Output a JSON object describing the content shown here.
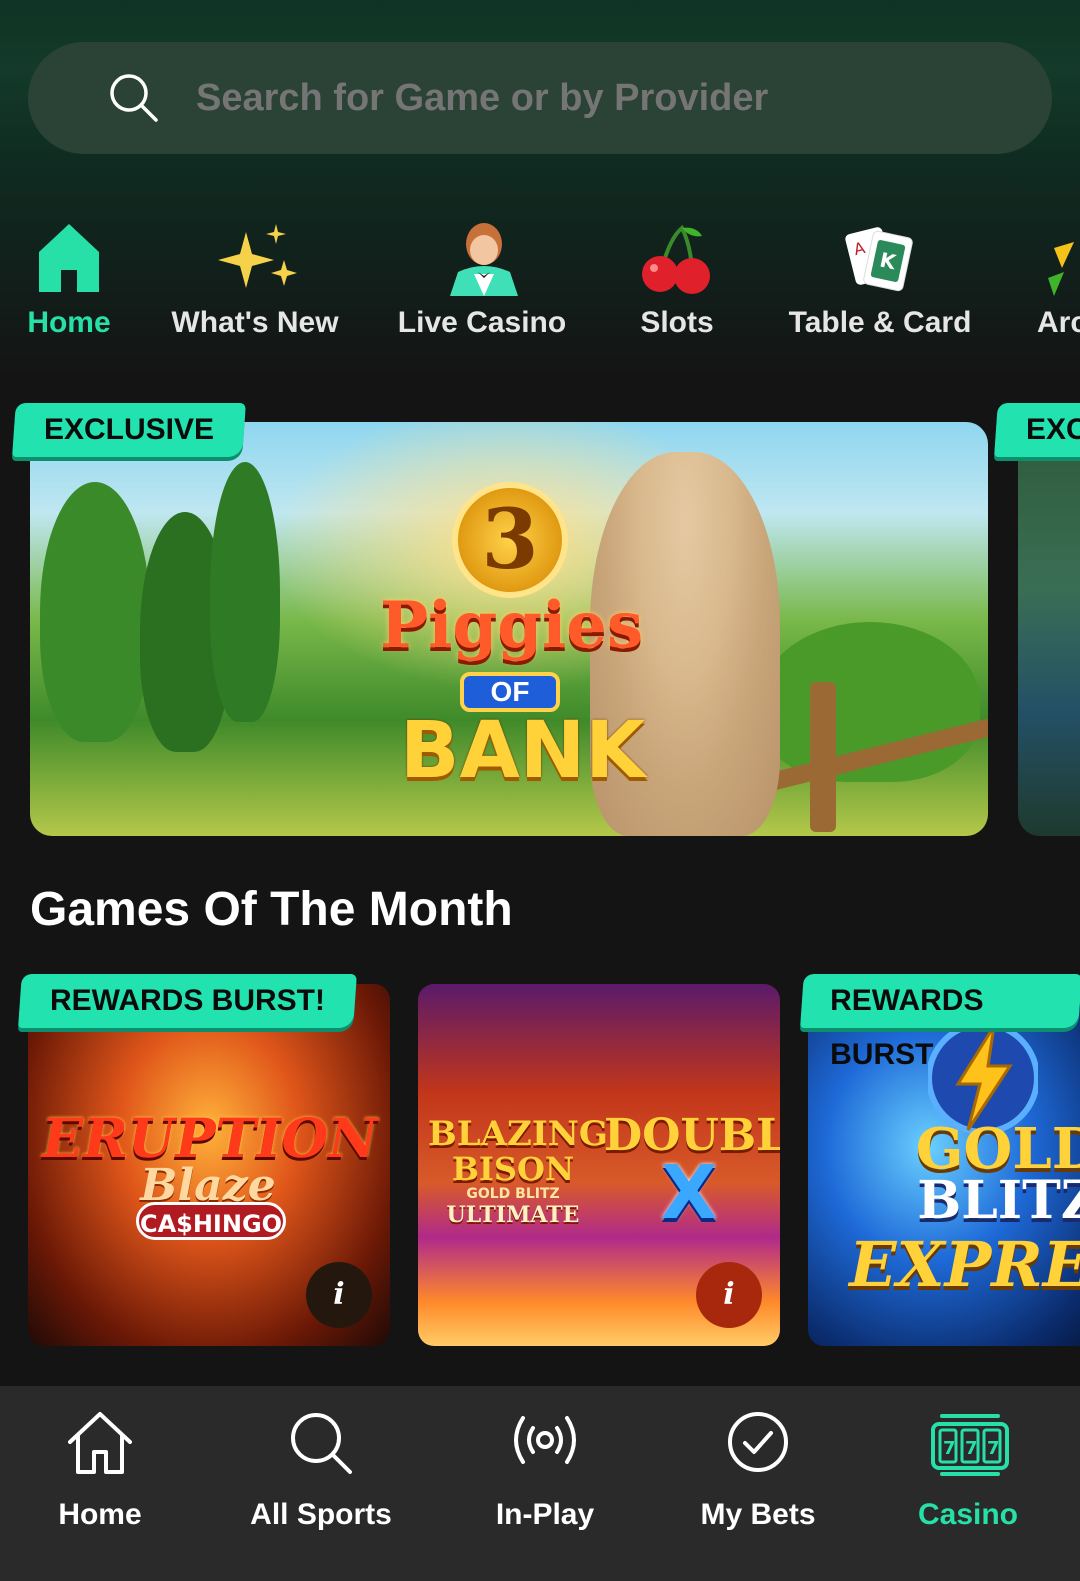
{
  "search": {
    "placeholder": "Search for Game or by Provider"
  },
  "categories": [
    {
      "label": "Home",
      "icon": "home-icon",
      "active": true
    },
    {
      "label": "What's New",
      "icon": "sparkles-icon"
    },
    {
      "label": "Live Casino",
      "icon": "dealer-icon"
    },
    {
      "label": "Slots",
      "icon": "cherries-icon"
    },
    {
      "label": "Table & Card",
      "icon": "playing-cards-icon"
    },
    {
      "label": "Arc",
      "icon": "arcade-icon"
    }
  ],
  "banners": [
    {
      "tag": "EXCLUSIVE",
      "logo": {
        "number": "3",
        "line1": "Piggies",
        "line2": "OF",
        "line3": "BANK"
      }
    },
    {
      "tag": "EXC"
    }
  ],
  "games_section": {
    "title": "Games Of The Month",
    "games": [
      {
        "tag": "REWARDS BURST!",
        "title_lines": [
          "ERUPTION",
          "Blaze",
          "CA$HINGO"
        ],
        "info": "i"
      },
      {
        "tag": "",
        "title_lines": [
          "BLAZING",
          "BISON",
          "GOLD BLITZ",
          "ULTIMATE",
          "DOUBLE",
          "X"
        ],
        "info": "i"
      },
      {
        "tag": "REWARDS BURST",
        "title_lines": [
          "GOLD",
          "BLITZ",
          "EXPRES"
        ]
      }
    ]
  },
  "bottom_nav": [
    {
      "label": "Home",
      "icon": "home-outline-icon"
    },
    {
      "label": "All Sports",
      "icon": "search-icon"
    },
    {
      "label": "In-Play",
      "icon": "broadcast-icon"
    },
    {
      "label": "My Bets",
      "icon": "check-circle-icon"
    },
    {
      "label": "Casino",
      "icon": "slot-machine-icon",
      "active": true
    }
  ],
  "colors": {
    "accent": "#27e0a8",
    "tag_bg": "#22e3b0",
    "nav_bg": "#2a2a2a",
    "search_bg": "#2a4336"
  }
}
